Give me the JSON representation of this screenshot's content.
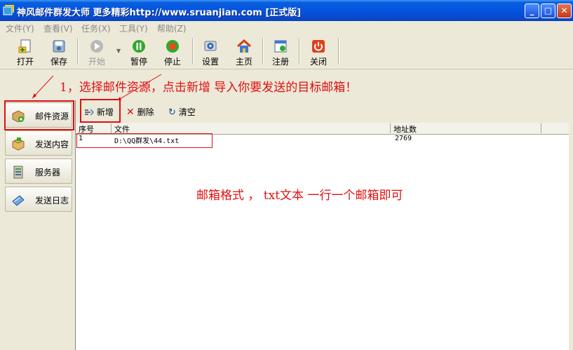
{
  "window": {
    "title": "神风邮件群发大师 更多精彩http://www.sruanjian.com  [正式版]",
    "controls": {
      "minimize": "_",
      "maximize": "□",
      "close": "✕"
    }
  },
  "menu": [
    {
      "label": "文件(Y)"
    },
    {
      "label": "查看(V)"
    },
    {
      "label": "任务(X)"
    },
    {
      "label": "工具(Y)"
    },
    {
      "label": "帮助(Z)"
    }
  ],
  "toolbar": [
    {
      "label": "打开",
      "icon": "open-file-icon",
      "enabled": true
    },
    {
      "label": "保存",
      "icon": "save-disk-icon",
      "enabled": true
    },
    {
      "label": "开始",
      "icon": "play-icon",
      "enabled": false
    },
    {
      "label": "暂停",
      "icon": "pause-icon",
      "enabled": true
    },
    {
      "label": "停止",
      "icon": "stop-icon",
      "enabled": true
    },
    {
      "label": "设置",
      "icon": "settings-icon",
      "enabled": true
    },
    {
      "label": "主页",
      "icon": "home-icon",
      "enabled": true
    },
    {
      "label": "注册",
      "icon": "register-icon",
      "enabled": true
    },
    {
      "label": "关闭",
      "icon": "power-icon",
      "enabled": true
    }
  ],
  "annotations": {
    "step1": "1，选择邮件资源，点击新增  导入你要发送的目标邮箱！",
    "format": "邮箱格式 ， txt文本 一行一个邮箱即可"
  },
  "leftnav": [
    {
      "label": "邮件资源",
      "icon": "package-add-icon",
      "active": true
    },
    {
      "label": "发送内容",
      "icon": "box-content-icon",
      "active": false
    },
    {
      "label": "服务器",
      "icon": "server-icon",
      "active": false
    },
    {
      "label": "发送日志",
      "icon": "log-book-icon",
      "active": false
    }
  ],
  "content_toolbar": {
    "add": "新增",
    "delete": "删除",
    "clear": "清空"
  },
  "table": {
    "columns": [
      "序号",
      "文件",
      "地址数"
    ],
    "rows": [
      {
        "index": "1",
        "file": "D:\\QQ群发\\44.txt",
        "count": "2769"
      }
    ]
  },
  "colors": {
    "annotation": "#e01010",
    "titlebar": "#0454e0"
  }
}
